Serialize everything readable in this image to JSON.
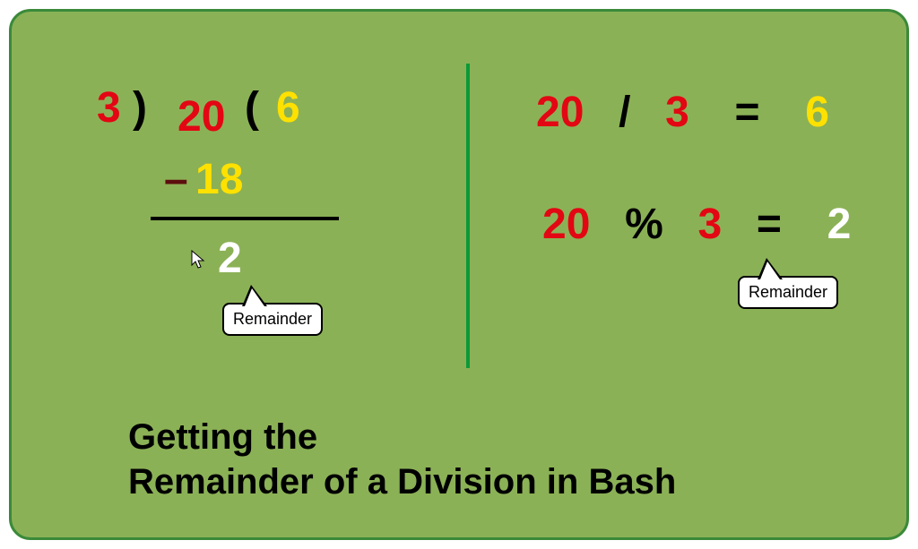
{
  "long_division": {
    "divisor": "3",
    "right_paren": ")",
    "dividend": "20",
    "left_paren": "(",
    "quotient": "6",
    "minus": "–",
    "product": "18",
    "remainder": "2"
  },
  "callouts": {
    "left_label": "Remainder",
    "right_label": "Remainder"
  },
  "equations": {
    "div_lhs_a": "20",
    "div_op": "/",
    "div_lhs_b": "3",
    "equals": "=",
    "div_result": "6",
    "mod_lhs_a": "20",
    "mod_op": "%",
    "mod_lhs_b": "3",
    "mod_result": "2"
  },
  "title": {
    "line1": "Getting the",
    "line2": "Remainder of a Division in Bash"
  }
}
